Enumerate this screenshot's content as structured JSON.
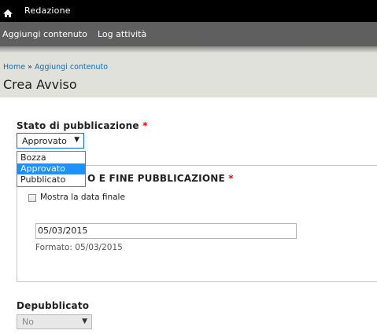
{
  "toolbar": {
    "title": "Redazione",
    "home_icon": "home-icon"
  },
  "tray": {
    "links": [
      "Aggiungi contenuto",
      "Log attività"
    ]
  },
  "breadcrumb": {
    "home": "Home",
    "separator": "»",
    "current": "Aggiungi contenuto"
  },
  "page_title": "Crea Avviso",
  "status_field": {
    "label": "Stato di pubblicazione",
    "required_mark": "*",
    "value": "Approvato",
    "options": [
      "Bozza",
      "Approvato",
      "Pubblicato"
    ],
    "selected_index": 1
  },
  "dates_fieldset": {
    "legend": "O E FINE PUBBLICAZIONE",
    "required_mark": "*",
    "show_end_label": "Mostra la data finale",
    "show_end_checked": false,
    "date_value": "05/03/2015",
    "format_hint": "Formato: 05/03/2015"
  },
  "unpublished_field": {
    "label": "Depubblicato",
    "value": "No"
  },
  "colors": {
    "accent": "#1e90ff",
    "link": "#0074bd",
    "required": "#e00000"
  }
}
